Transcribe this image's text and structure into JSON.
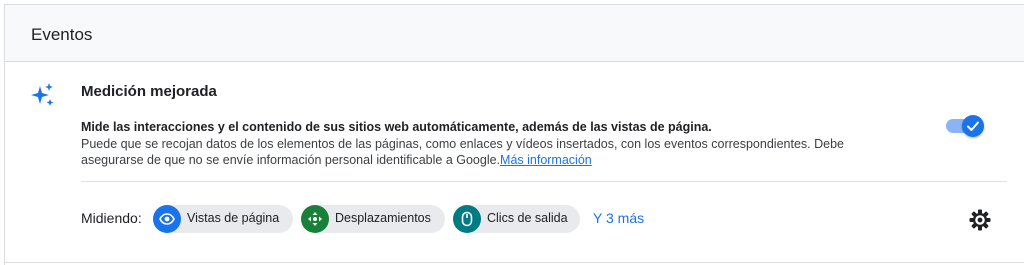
{
  "header": {
    "title": "Eventos"
  },
  "section": {
    "title": "Medición mejorada",
    "description_strong": "Mide las interacciones y el contenido de sus sitios web automáticamente, además de las vistas de página.",
    "description_line1": "Puede que se recojan datos de los elementos de las páginas, como enlaces y vídeos insertados, con los eventos correspondientes. Debe",
    "description_line2": "asegurarse de que no se envíe información personal identificable a Google.",
    "learn_more": "Más información",
    "toggle_on": true
  },
  "measuring": {
    "label": "Midiendo:",
    "chips": [
      {
        "label": "Vistas de página",
        "icon": "eye-icon",
        "color": "#1a73e8"
      },
      {
        "label": "Desplazamientos",
        "icon": "scroll-arrows-icon",
        "color": "#188038"
      },
      {
        "label": "Clics de salida",
        "icon": "mouse-icon",
        "color": "#007b83"
      }
    ],
    "more_link": "Y 3 más"
  },
  "colors": {
    "accent": "#1a73e8",
    "green": "#188038",
    "teal": "#007b83"
  }
}
